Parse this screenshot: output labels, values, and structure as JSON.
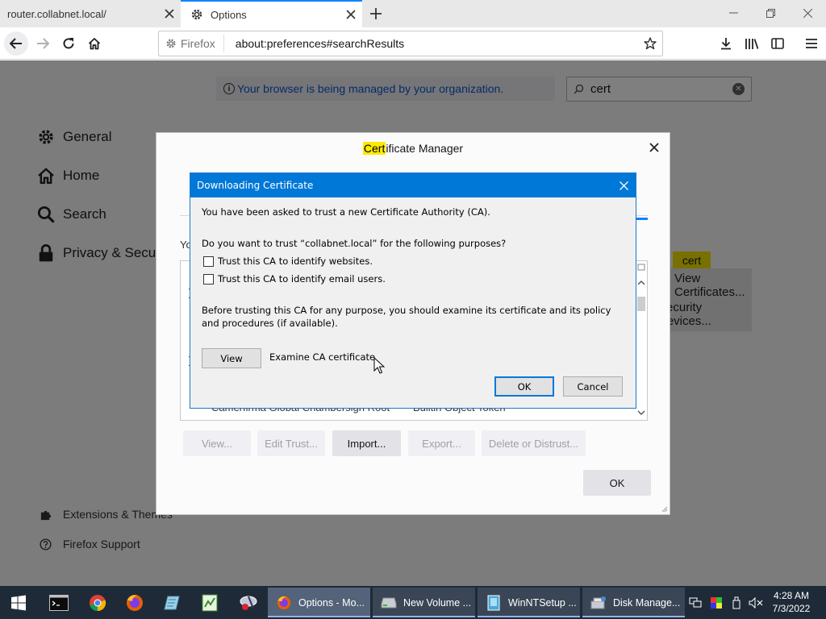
{
  "browser": {
    "tabs": [
      {
        "title": "router.collabnet.local/",
        "active": false
      },
      {
        "title": "Options",
        "active": true
      }
    ],
    "identity_label": "Firefox",
    "url": "about:preferences#searchResults",
    "accent_color": "#0a84ff"
  },
  "prefs": {
    "policy_notice": "Your browser is being managed by your organization.",
    "search_query": "cert",
    "categories": [
      {
        "label": "General",
        "icon": "gear-icon"
      },
      {
        "label": "Home",
        "icon": "home-icon"
      },
      {
        "label": "Search",
        "icon": "search-icon"
      },
      {
        "label": "Privacy & Security",
        "icon": "lock-icon"
      }
    ],
    "footer": [
      {
        "label": "Extensions & Themes",
        "icon": "puzzle-icon"
      },
      {
        "label": "Firefox Support",
        "icon": "help-icon"
      }
    ],
    "highlight_word": "cert",
    "view_certificates_label": "View Certificates...",
    "security_devices_label": "Security Devices..."
  },
  "cert_manager": {
    "title_highlight": "Cert",
    "title_rest": "ificate Manager",
    "intro_fragment": "Yo",
    "tree_row": {
      "name": "Camerfirma Global Chambersign Root",
      "token": "Builtin Object Token"
    },
    "buttons": {
      "view": "View...",
      "edit_trust": "Edit Trust...",
      "import": "Import...",
      "export": "Export...",
      "delete": "Delete or Distrust..."
    },
    "ok_label": "OK"
  },
  "download_dialog": {
    "title": "Downloading Certificate",
    "intro": "You have been asked to trust a new Certificate Authority (CA).",
    "question": "Do you want to trust “collabnet.local” for the following purposes?",
    "checkboxes": [
      {
        "label": "Trust this CA to identify websites.",
        "checked": false
      },
      {
        "label": "Trust this CA to identify email users.",
        "checked": false
      }
    ],
    "advice": "Before trusting this CA for any purpose, you should examine its certificate and its policy and procedures (if available).",
    "view_button": "View",
    "view_description": "Examine CA certificate",
    "ok_button": "OK",
    "cancel_button": "Cancel",
    "title_color": "#0078d7"
  },
  "taskbar": {
    "tasks": [
      {
        "label": "Options - Mo...",
        "icon": "firefox-icon",
        "active": true
      },
      {
        "label": "New Volume ...",
        "icon": "drive-icon",
        "active": false
      },
      {
        "label": "WinNTSetup ...",
        "icon": "setup-icon",
        "active": false
      },
      {
        "label": "Disk Manage...",
        "icon": "disk-icon",
        "active": false
      }
    ],
    "time": "4:28 AM",
    "date": "7/3/2022"
  }
}
